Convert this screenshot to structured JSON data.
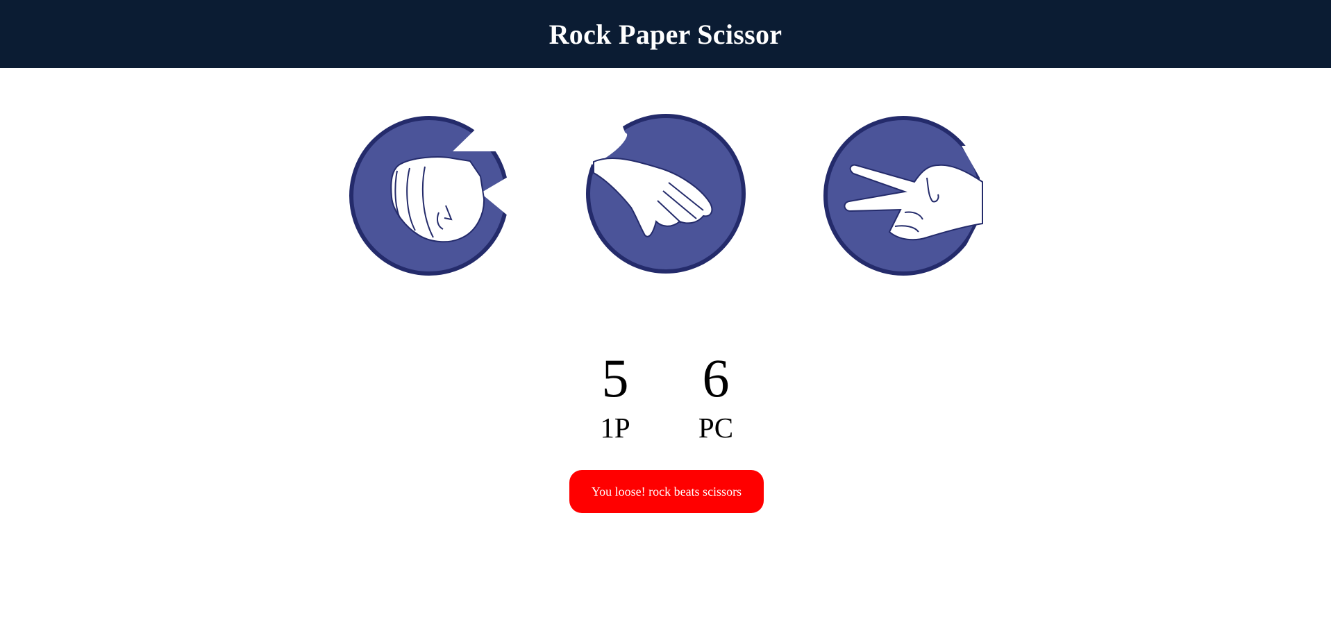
{
  "header": {
    "title": "Rock Paper Scissor"
  },
  "choices": [
    {
      "name": "rock",
      "icon": "rock-hand-icon"
    },
    {
      "name": "paper",
      "icon": "paper-hand-icon"
    },
    {
      "name": "scissors",
      "icon": "scissors-hand-icon"
    }
  ],
  "scoreboard": {
    "player": {
      "score": "5",
      "label": "1P"
    },
    "pc": {
      "score": "6",
      "label": "PC"
    }
  },
  "result": {
    "message": "You loose! rock beats scissors",
    "color": "#ff0000"
  },
  "colors": {
    "header_bg": "#0b1c33",
    "circle_fill": "#4b5499",
    "circle_border": "#242b6b"
  }
}
